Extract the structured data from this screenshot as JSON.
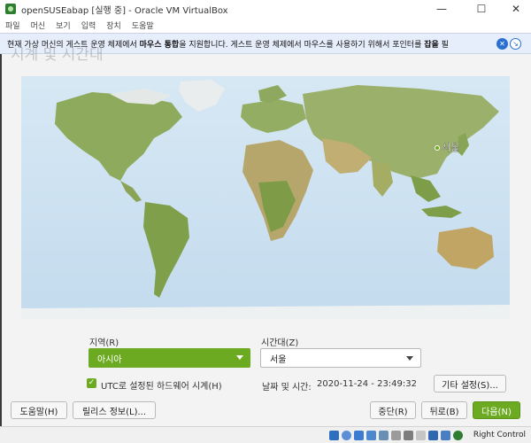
{
  "window": {
    "title": "openSUSEabap [실행 중] - Oracle VM VirtualBox",
    "minimize_glyph": "—",
    "maximize_glyph": "☐",
    "close_glyph": "✕"
  },
  "menu": [
    "파일",
    "머신",
    "보기",
    "입력",
    "장치",
    "도움말"
  ],
  "notification": {
    "text_before": "현재 가상 머신의 게스트 운영 체제에서 ",
    "text_bold1": "마우스 통합",
    "text_middle": "을 지원합니다. 게스트 운영 체제에서 마우스를 사용하기 위해서 포인터를 ",
    "text_bold2": "잡을",
    "text_after": " 필",
    "icons": [
      "info-close-icon",
      "mouse-integration-icon"
    ]
  },
  "page": {
    "title": "시계 및 시간대"
  },
  "map": {
    "selected_city": "서울"
  },
  "form": {
    "region_label": "지역(R)",
    "region_value": "아시아",
    "timezone_label": "시간대(Z)",
    "timezone_value": "서울",
    "hw_clock_utc_label": "UTC로 설정된 하드웨어 시계(H)",
    "hw_clock_utc_checked": true,
    "datetime_label": "날짜 및 시간:",
    "datetime_value": "2020-11-24 - 23:49:32",
    "other_settings_label": "기타 설정(S)..."
  },
  "buttons": {
    "help": "도움말(H)",
    "release_notes": "릴리스 정보(L)...",
    "abort": "중단(R)",
    "back": "뒤로(B)",
    "next": "다음(N)"
  },
  "statusbar": {
    "host_key": "Right Control"
  },
  "colors": {
    "accent": "#6cab21",
    "ocean": "#cfe3f2",
    "land": "#8eaa5c"
  }
}
